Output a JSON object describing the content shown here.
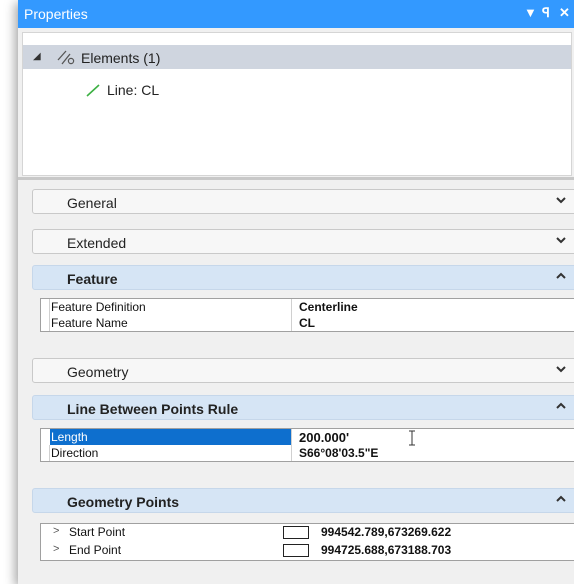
{
  "window": {
    "title": "Properties",
    "controls": {
      "dropdown": "▼",
      "pin": "ᵖ",
      "close": "✕"
    }
  },
  "tree": {
    "root": {
      "expander": "◢",
      "label": "Elements (1)",
      "icon": "elements-icon"
    },
    "child": {
      "label": "Line: CL",
      "icon": "line-icon",
      "icon_color": "#3cb043"
    }
  },
  "sections": {
    "general": {
      "label": "General",
      "expanded": false
    },
    "extended": {
      "label": "Extended",
      "expanded": false
    },
    "feature": {
      "label": "Feature",
      "expanded": true,
      "rows": [
        {
          "name": "Feature Definition",
          "value": "Centerline"
        },
        {
          "name": "Feature Name",
          "value": "CL"
        }
      ]
    },
    "geometry": {
      "label": "Geometry",
      "expanded": false
    },
    "line_rule": {
      "label": "Line Between Points Rule",
      "expanded": true,
      "rows": [
        {
          "name": "Length",
          "value": "200.000'",
          "selected": true
        },
        {
          "name": "Direction",
          "value": "S66°08'03.5\"E"
        }
      ]
    },
    "geometry_points": {
      "label": "Geometry Points",
      "expanded": true,
      "rows": [
        {
          "name": "Start Point",
          "value": "994542.789,673269.622"
        },
        {
          "name": "End Point",
          "value": "994725.688,673188.703"
        }
      ]
    }
  },
  "colors": {
    "titlebar": "#3399ff",
    "section_open": "#d6e5f5",
    "selection": "#0e6fce"
  }
}
